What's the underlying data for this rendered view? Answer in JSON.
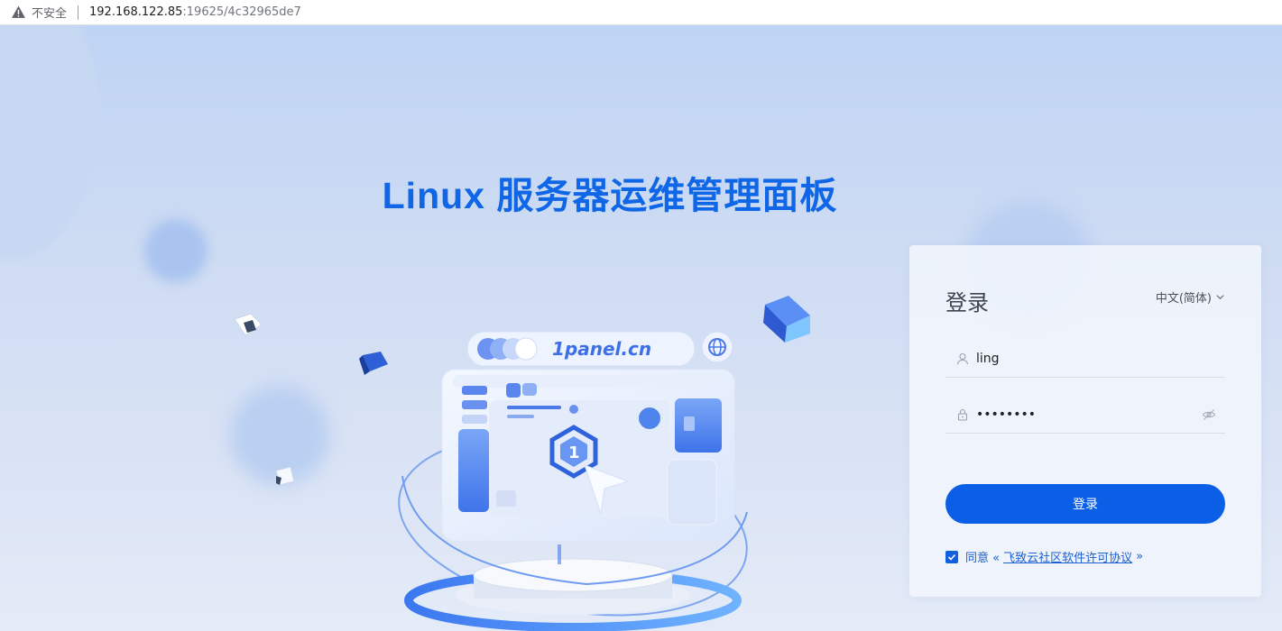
{
  "browser": {
    "security_label": "不安全",
    "url_host": "192.168.122.85",
    "url_rest": ":19625/4c32965de7"
  },
  "page": {
    "headline": "Linux 服务器运维管理面板",
    "illustration_brand": "1panel.cn"
  },
  "login": {
    "title": "登录",
    "language": "中文(简体)",
    "username_value": "ling",
    "password_value": "••••••••",
    "submit_label": "登录",
    "agree_prefix": "同意 «",
    "agree_link": "飞致云社区软件许可协议",
    "agree_suffix": "»",
    "agree_checked": true
  },
  "colors": {
    "accent": "#0a5fe6",
    "headline": "#0f66e6",
    "background": "#c9daf3"
  },
  "icons": {
    "security": "warning-triangle-icon",
    "language": "chevron-down-icon",
    "username": "user-icon",
    "password": "lock-icon",
    "toggle_password": "eye-off-icon",
    "agree": "checkmark-icon"
  }
}
